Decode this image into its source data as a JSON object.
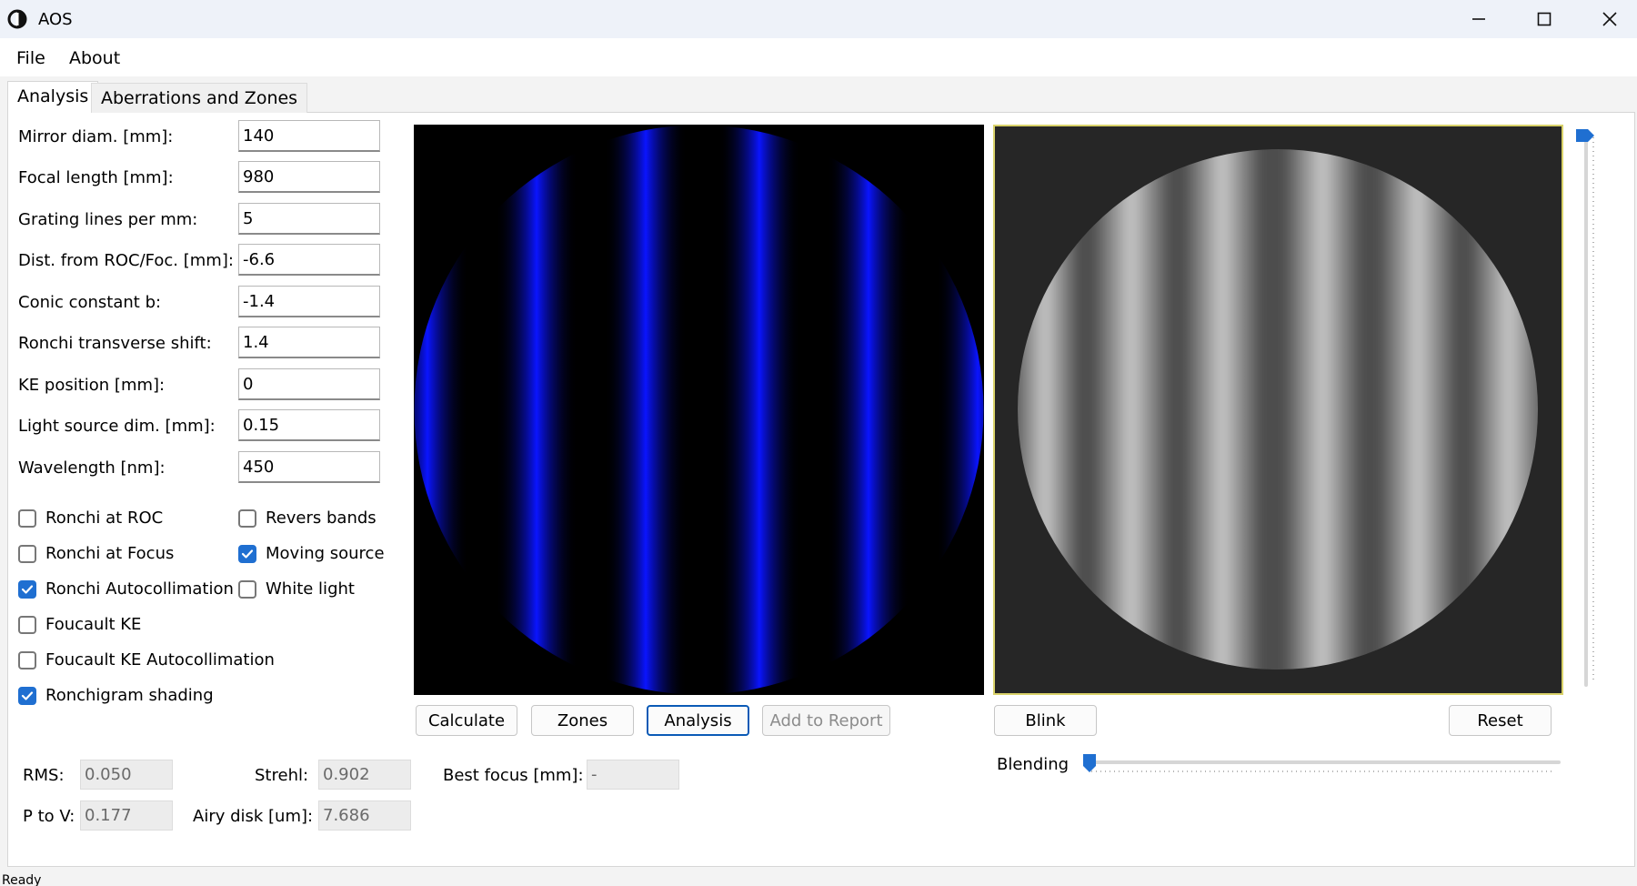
{
  "window": {
    "title": "AOS"
  },
  "menu": {
    "file": "File",
    "about": "About"
  },
  "tabs": [
    {
      "label": "Analysis",
      "active": true
    },
    {
      "label": "Aberrations and Zones",
      "active": false
    }
  ],
  "fields": [
    {
      "label": "Mirror diam. [mm]:",
      "value": "140"
    },
    {
      "label": "Focal length [mm]:",
      "value": "980"
    },
    {
      "label": "Grating lines per mm:",
      "value": "5"
    },
    {
      "label": "Dist. from ROC/Foc. [mm]:",
      "value": "-6.6"
    },
    {
      "label": "Conic constant b:",
      "value": "-1.4"
    },
    {
      "label": "Ronchi transverse shift:",
      "value": "1.4"
    },
    {
      "label": "KE position [mm]:",
      "value": "0"
    },
    {
      "label": "Light source dim. [mm]:",
      "value": "0.15"
    },
    {
      "label": "Wavelength [nm]:",
      "value": "450"
    }
  ],
  "checkboxes": {
    "ronchi_roc": {
      "label": "Ronchi at ROC",
      "checked": false
    },
    "ronchi_focus": {
      "label": "Ronchi at Focus",
      "checked": false
    },
    "ronchi_autocoll": {
      "label": "Ronchi Autocollimation",
      "checked": true
    },
    "foucault_ke": {
      "label": "Foucault KE",
      "checked": false
    },
    "foucault_ke_autocoll": {
      "label": "Foucault KE Autocollimation",
      "checked": false
    },
    "ronchigram_shading": {
      "label": "Ronchigram shading",
      "checked": true
    },
    "revers_bands": {
      "label": "Revers bands",
      "checked": false
    },
    "moving_source": {
      "label": "Moving source",
      "checked": true
    },
    "white_light": {
      "label": "White light",
      "checked": false
    }
  },
  "buttons": {
    "calculate": "Calculate",
    "zones": "Zones",
    "analysis": "Analysis",
    "add_to_report": "Add to Report",
    "blink": "Blink",
    "reset": "Reset"
  },
  "results": {
    "rms_label": "RMS:",
    "rms_value": "0.050",
    "ptov_label": "P to V:",
    "ptov_value": "0.177",
    "strehl_label": "Strehl:",
    "strehl_value": "0.902",
    "airy_label": "Airy disk [um]:",
    "airy_value": "7.686",
    "best_focus_label": "Best focus [mm]:",
    "best_focus_value": "-"
  },
  "blending": {
    "label": "Blending",
    "value": 0
  },
  "vertical_slider": {
    "value": 1.0
  },
  "status": {
    "text": "Ready"
  },
  "colors": {
    "accent": "#1f6fd1",
    "band_blue": "#0a14ff",
    "focus_border": "#0a5ab6"
  }
}
